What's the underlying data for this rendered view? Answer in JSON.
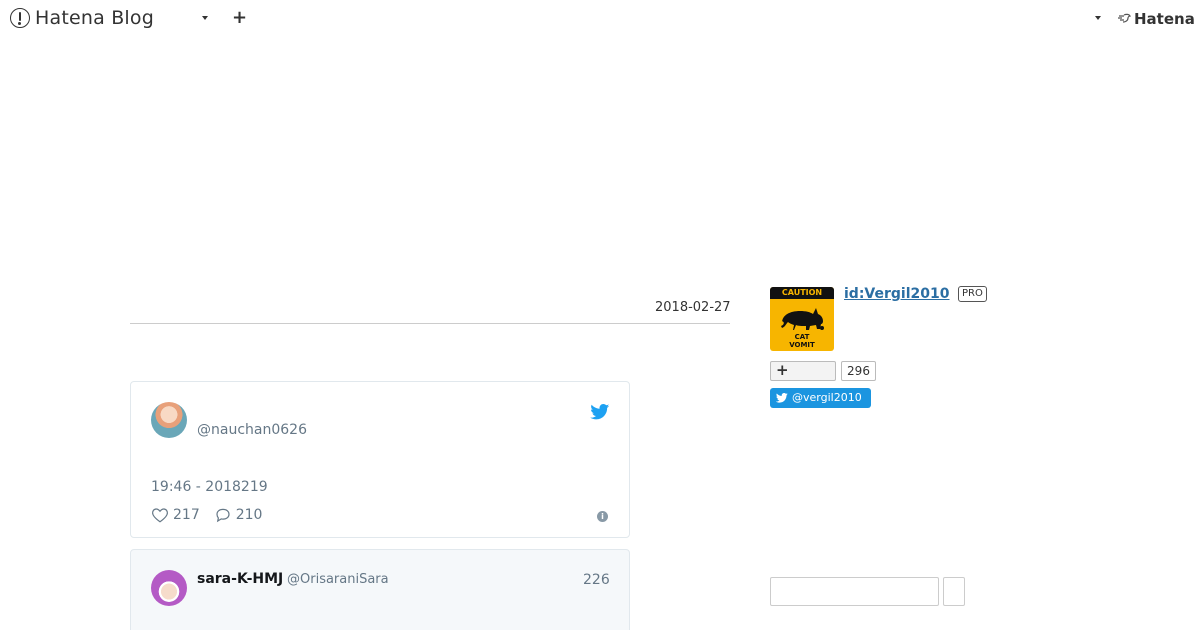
{
  "header": {
    "logo_text": "Hatena Blog",
    "add_label": "+",
    "right_brand": "Hatena"
  },
  "article": {
    "date": "2018-02-27"
  },
  "tweets": [
    {
      "handle": "@nauchan0626",
      "time": "19:46 - 2018219",
      "likes": "217",
      "replies": "210"
    },
    {
      "name": "sara-K-HMJ",
      "handle": "@OrisaraniSara",
      "count": "226"
    }
  ],
  "sidebar": {
    "profile_image_text": {
      "top": "CAUTION",
      "bottom_line1": "CAT",
      "bottom_line2": "VOMIT"
    },
    "user_id": "id:Vergil2010",
    "badge": "PRO",
    "subscribe_icon": "+",
    "subscriber_count": "296",
    "twitter_follow": "@vergil2010",
    "search_value": ""
  },
  "colors": {
    "link": "#2b6ea3",
    "twitter_blue": "#1da1f2",
    "follow_button": "#1b95e0",
    "caution_yellow": "#f7b500"
  }
}
